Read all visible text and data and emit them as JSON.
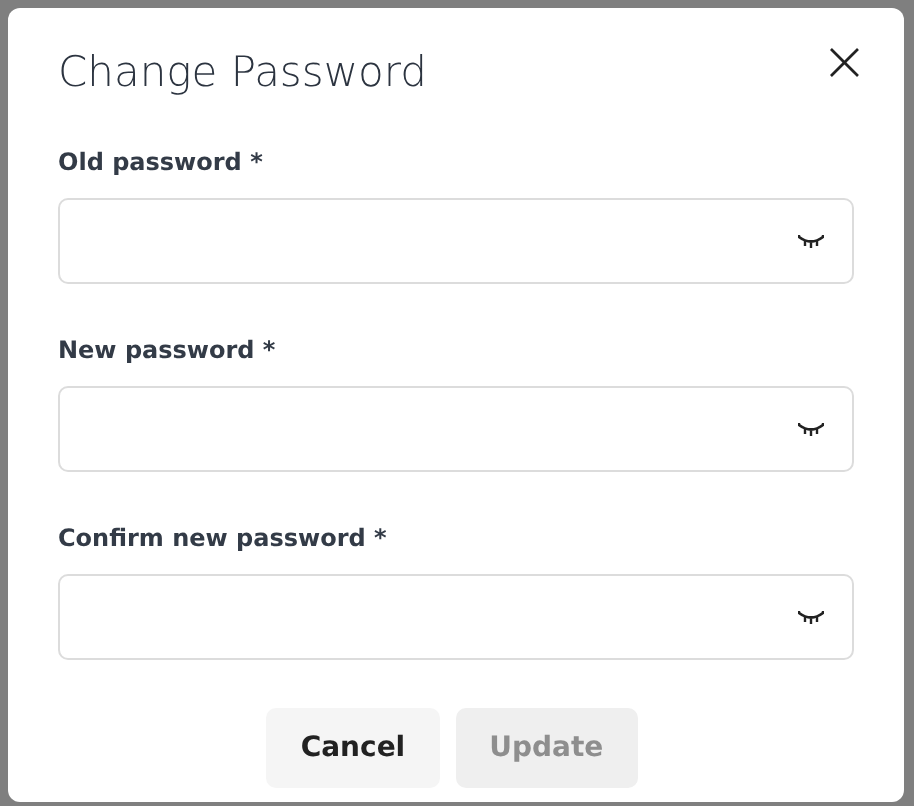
{
  "dialog": {
    "title": "Change Password",
    "close": "×"
  },
  "fields": [
    {
      "label": "Old password *"
    },
    {
      "label": "New password *"
    },
    {
      "label": "Confirm new password *"
    }
  ],
  "buttons": [
    {
      "label": "Cancel",
      "disabled": false
    },
    {
      "label": "Update",
      "disabled": true
    }
  ]
}
